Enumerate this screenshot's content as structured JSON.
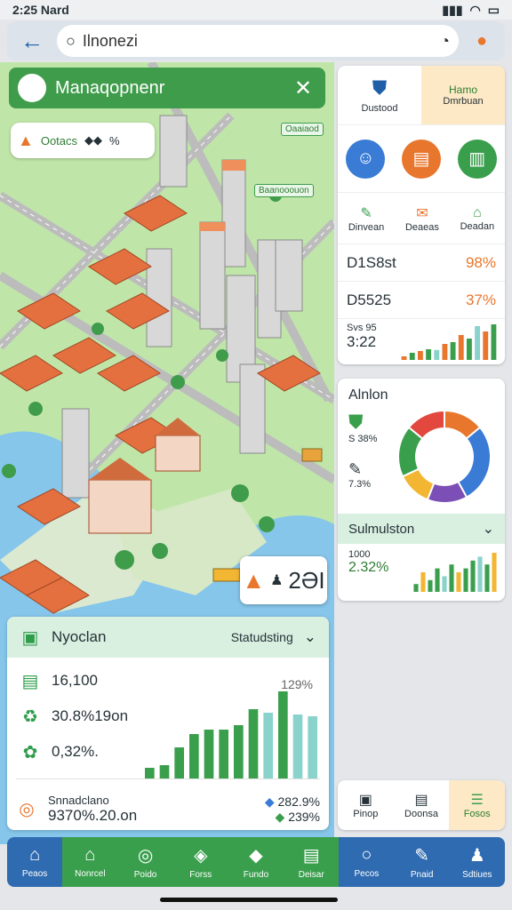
{
  "status": {
    "time": "2:25",
    "carrier": "Nard",
    "signal": "⁴⁶ᴵᴵ"
  },
  "search": {
    "value": "Ilnonezi",
    "placeholder": "Ilnonezi"
  },
  "map": {
    "header_title": "Manaqopnenr",
    "chip_label": "Ootacs",
    "chip_value": "%",
    "labels": [
      "Oaaiaod",
      "Baanooouon"
    ],
    "population": "2ӘI"
  },
  "panel": {
    "title": "Nyoclan",
    "dropdown": "Statudsting",
    "rows": [
      {
        "label": "16,100",
        "right": "129%"
      },
      {
        "label": "30.8%19on",
        "right": ""
      },
      {
        "label": "0,32%.",
        "right": ""
      }
    ],
    "footer_label": "Snnadclano",
    "footer_value": "9370%.20.on",
    "footer_right_top": "282.9%",
    "footer_right_bottom": "239%",
    "chart_bars": [
      0.12,
      0.15,
      0.35,
      0.5,
      0.55,
      0.55,
      0.6,
      0.78,
      0.74,
      0.98,
      0.72,
      0.7
    ]
  },
  "right": {
    "top_tab": "Hamo",
    "top_tab_sub": "Dmrbuan",
    "top_logo_label": "Dustood",
    "icon_labels": [
      "Dinvean",
      "Deaeas",
      "Deadan"
    ],
    "metric1_label": "D1S8st",
    "metric1_value": "98%",
    "metric2_label": "D5525",
    "metric2_value": "37%",
    "mini_label": "Svs 95",
    "mini_value": "3:22",
    "mini_bars": [
      0.1,
      0.2,
      0.25,
      0.3,
      0.28,
      0.45,
      0.5,
      0.7,
      0.6,
      0.95,
      0.8,
      1.0
    ],
    "donut_title": "Alnlon",
    "donut_val1": "S 38%",
    "donut_val2": "7.3%",
    "donut_segments": [
      {
        "color": "#e8762d",
        "value": 14
      },
      {
        "color": "#3a7bd5",
        "value": 28
      },
      {
        "color": "#7b4fb5",
        "value": 14
      },
      {
        "color": "#f2b632",
        "value": 12
      },
      {
        "color": "#3a9f4d",
        "value": 18
      },
      {
        "color": "#e2483d",
        "value": 14
      }
    ],
    "sim_title": "Sulmulston",
    "sim_small": "1000",
    "sim_value": "2.32%",
    "sim_bars": [
      0.2,
      0.5,
      0.3,
      0.6,
      0.4,
      0.7,
      0.5,
      0.6,
      0.8,
      0.9,
      0.7,
      1.0
    ],
    "bottom_tabs": [
      "Pinop",
      "Doonsa",
      "Fosos"
    ]
  },
  "nav": {
    "items": [
      "Peaos",
      "Nonrcel",
      "Poido",
      "Forss",
      "Fundo",
      "Deisar",
      "Pecos",
      "Pnaid",
      "Sdtiues"
    ]
  },
  "colors": {
    "green": "#3a9f4d",
    "blue": "#2f6bb0",
    "orange": "#e8762d"
  }
}
